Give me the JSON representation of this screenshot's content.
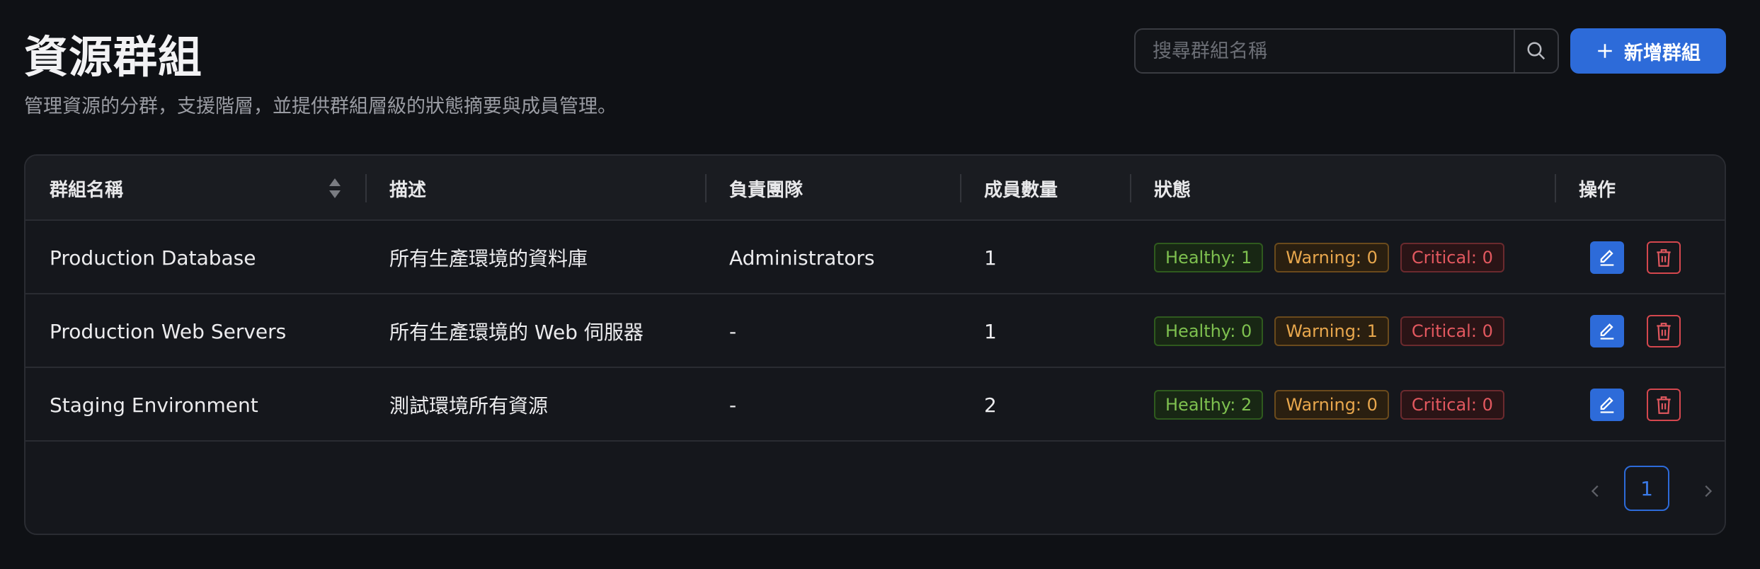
{
  "header": {
    "title": "資源群組",
    "subtitle": "管理資源的分群，支援階層，並提供群組層級的狀態摘要與成員管理。",
    "search_placeholder": "搜尋群組名稱",
    "add_button_label": "新增群組"
  },
  "table": {
    "columns": {
      "name": "群組名稱",
      "description": "描述",
      "team": "負責團隊",
      "members": "成員數量",
      "status": "狀態",
      "actions": "操作"
    },
    "rows": [
      {
        "name": "Production Database",
        "description": "所有生產環境的資料庫",
        "team": "Administrators",
        "members": "1",
        "healthy": "Healthy: 1",
        "warning": "Warning: 0",
        "critical": "Critical: 0"
      },
      {
        "name": "Production Web Servers",
        "description": "所有生產環境的 Web 伺服器",
        "team": "-",
        "members": "1",
        "healthy": "Healthy: 0",
        "warning": "Warning: 1",
        "critical": "Critical: 0"
      },
      {
        "name": "Staging Environment",
        "description": "測試環境所有資源",
        "team": "-",
        "members": "2",
        "healthy": "Healthy: 2",
        "warning": "Warning: 0",
        "critical": "Critical: 0"
      }
    ]
  },
  "pagination": {
    "current_page": "1"
  },
  "colors": {
    "background": "#0f1115",
    "accent": "#2d6bd9",
    "healthy": "#7ec04f",
    "warning": "#e8a74d",
    "critical": "#e2585f"
  },
  "icons": [
    "search-icon",
    "plus-icon",
    "sort-icon",
    "edit-icon",
    "trash-icon",
    "chevron-left-icon",
    "chevron-right-icon"
  ]
}
